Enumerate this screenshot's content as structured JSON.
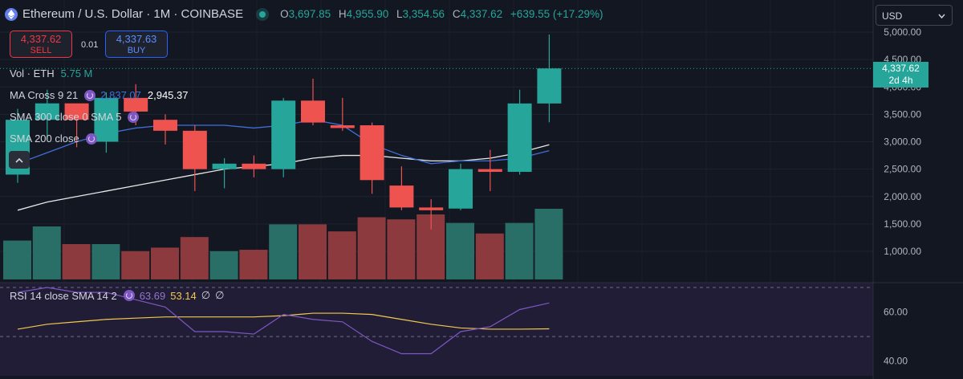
{
  "header": {
    "title": "Ethereum / U.S. Dollar · 1M · COINBASE",
    "ohlc": [
      {
        "k": "O",
        "v": "3,697.85"
      },
      {
        "k": "H",
        "v": "4,955.90"
      },
      {
        "k": "L",
        "v": "3,354.56"
      },
      {
        "k": "C",
        "v": "4,337.62"
      }
    ],
    "change": "+639.55 (+17.29%)"
  },
  "trade": {
    "sell_price": "4,337.62",
    "sell_label": "SELL",
    "spread": "0.01",
    "buy_price": "4,337.63",
    "buy_label": "BUY"
  },
  "indicators": {
    "vol": {
      "name": "Vol · ETH",
      "value": "5.75 M"
    },
    "ma_cross": {
      "name": "MA Cross 9 21",
      "v1": "2,837.07",
      "v2": "2,945.37"
    },
    "sma300": {
      "name": "SMA 300 close 0 SMA 5"
    },
    "sma200": {
      "name": "SMA 200 close"
    },
    "rsi": {
      "name": "RSI 14 close SMA 14 2",
      "v1": "63.69",
      "v2": "53.14",
      "v3": "∅",
      "v4": "∅"
    }
  },
  "currency": {
    "value": "USD"
  },
  "price_label": {
    "price": "4,337.62",
    "countdown": "2d 4h"
  },
  "icons": {
    "currency_dropdown": "chevron-down-icon",
    "collapse": "chevron-up-icon",
    "symbol": "ethereum-icon"
  },
  "colors": {
    "up": "#26a69a",
    "down": "#ef5350",
    "ma_fast": "#3f6fd8",
    "ma_slow": "#e8e8e8",
    "rsi": "#7e57c2",
    "rsi_ma": "#f2c94c"
  },
  "chart_data": [
    {
      "type": "candlestick",
      "price_axis": {
        "ticks": [
          "1,000.00",
          "1,500.00",
          "2,000.00",
          "2,500.00",
          "3,000.00",
          "3,500.00",
          "4,000.00",
          "4,500.00",
          "5,000.00"
        ],
        "range": [
          600,
          5100
        ]
      },
      "candles": [
        {
          "o": 2400,
          "h": 3600,
          "l": 2250,
          "c": 3400
        },
        {
          "o": 3400,
          "h": 3950,
          "l": 3050,
          "c": 3700
        },
        {
          "o": 3700,
          "h": 3550,
          "l": 2900,
          "c": 3400
        },
        {
          "o": 3000,
          "h": 3900,
          "l": 2800,
          "c": 3800
        },
        {
          "o": 3800,
          "h": 4050,
          "l": 3300,
          "c": 3550
        },
        {
          "o": 3400,
          "h": 3500,
          "l": 2950,
          "c": 3200
        },
        {
          "o": 3200,
          "h": 3300,
          "l": 2100,
          "c": 2500
        },
        {
          "o": 2500,
          "h": 2700,
          "l": 2150,
          "c": 2600
        },
        {
          "o": 2600,
          "h": 2750,
          "l": 2350,
          "c": 2500
        },
        {
          "o": 2500,
          "h": 3800,
          "l": 2350,
          "c": 3750
        },
        {
          "o": 3750,
          "h": 4150,
          "l": 3300,
          "c": 3350
        },
        {
          "o": 3300,
          "h": 3800,
          "l": 3200,
          "c": 3250
        },
        {
          "o": 3300,
          "h": 3350,
          "l": 2050,
          "c": 2300
        },
        {
          "o": 2200,
          "h": 2550,
          "l": 1750,
          "c": 1800
        },
        {
          "o": 1800,
          "h": 1950,
          "l": 1400,
          "c": 1750
        },
        {
          "o": 1780,
          "h": 2600,
          "l": 1750,
          "c": 2500
        },
        {
          "o": 2500,
          "h": 2850,
          "l": 2100,
          "c": 2450
        },
        {
          "o": 2450,
          "h": 3950,
          "l": 2400,
          "c": 3697.85
        },
        {
          "o": 3697.85,
          "h": 4955.9,
          "l": 3354.56,
          "c": 4337.62
        }
      ],
      "ma_fast": [
        2600,
        2800,
        3000,
        3150,
        3250,
        3300,
        3300,
        3300,
        3250,
        3300,
        3400,
        3300,
        2950,
        2750,
        2600,
        2650,
        2650,
        2700,
        2837.07
      ],
      "ma_slow": [
        1750,
        1900,
        2000,
        2100,
        2200,
        2300,
        2400,
        2500,
        2550,
        2600,
        2700,
        2750,
        2750,
        2700,
        2650,
        2650,
        2700,
        2800,
        2945.37
      ],
      "volumes": [
        0.55,
        0.75,
        0.5,
        0.5,
        0.4,
        0.45,
        0.6,
        0.4,
        0.42,
        0.78,
        0.78,
        0.68,
        0.88,
        0.85,
        0.92,
        0.8,
        0.65,
        0.8,
        1.0
      ]
    },
    {
      "type": "line",
      "name": "RSI",
      "axis": {
        "ticks": [
          "40.00",
          "60.00"
        ],
        "range": [
          34,
          70
        ]
      },
      "rsi": [
        68,
        70,
        68,
        68,
        65,
        62,
        52,
        52,
        51,
        59,
        57,
        56,
        48,
        43,
        43,
        52,
        54,
        61,
        63.69
      ],
      "rsi_ma": [
        53,
        55,
        56,
        57,
        57.5,
        58,
        58,
        58,
        58,
        58.5,
        59.5,
        59.5,
        59,
        57,
        55,
        53.5,
        53,
        53,
        53.14
      ]
    }
  ]
}
